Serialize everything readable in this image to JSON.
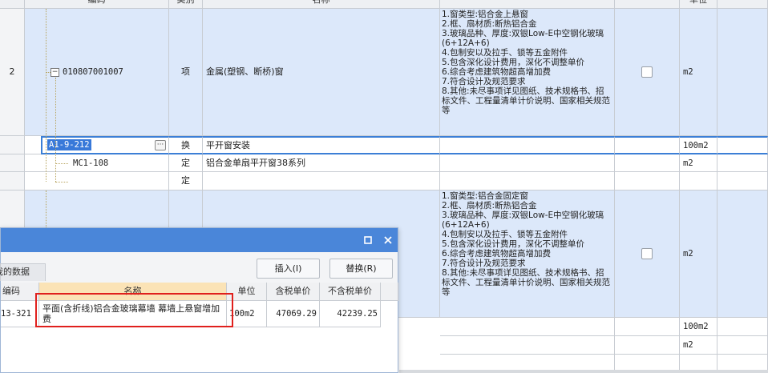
{
  "grid": {
    "header": {
      "code": "编码",
      "category": "类别",
      "name": "名称",
      "unit": "单位"
    },
    "rows": [
      {
        "num": "2",
        "code": "010807001007",
        "category": "项",
        "name": "金属(塑钢、断桥)窗",
        "features": "1.窗类型:铝合金上悬窗\n2.框、扇材质:断热铝合金\n3.玻璃品种、厚度:双银Low-E中空钢化玻璃(6+12A+6)\n4.包制安以及拉手、锁等五金附件\n5.包含深化设计费用，深化不调整单价\n6.综合考虑建筑物超高增加费\n7.符合设计及规范要求\n8.其他:未尽事项详见图纸、技术规格书、招标文件、工程量清单计价说明、国家相关规范等",
        "unit": "m2"
      },
      {
        "code": "A1-9-212",
        "category": "换",
        "name": "平开窗安装",
        "unit": "100m2",
        "edit_button": "···"
      },
      {
        "code": "MC1-108",
        "category": "定",
        "name": "铝合金单扇平开窗38系列",
        "unit": "m2"
      },
      {
        "code": "",
        "category": "定",
        "name": "",
        "unit": ""
      },
      {
        "features": "1.窗类型:铝合金固定窗\n2.框、扇材质:断热铝合金\n3.玻璃品种、厚度:双银Low-E中空钢化玻璃(6+12A+6)\n4.包制安以及拉手、锁等五金附件\n5.包含深化设计费用，深化不调整单价\n6.综合考虑建筑物超高增加费\n7.符合设计及规范要求\n8.其他:未尽事项详见图纸、技术规格书、招标文件、工程量清单计价说明、国家相关规范等",
        "unit": "m2"
      },
      {
        "unit": "100m2"
      },
      {
        "unit": "m2"
      }
    ]
  },
  "dialog": {
    "tab_label": "我的数据",
    "insert_button": "插入(I)",
    "replace_button": "替换(R)",
    "maximize_icon": "maximize-icon",
    "close_icon": "close-icon",
    "columns": {
      "code": "编码",
      "name": "名称",
      "unit": "单位",
      "tax_price": "含税单价",
      "notax_price": "不含税单价"
    },
    "row": {
      "code": "13-321",
      "name": "平面(含折线)铝合金玻璃幕墙 幕墙上悬窗增加费",
      "unit": "100m2",
      "tax_price": "47069.29",
      "notax_price": "42239.25"
    }
  },
  "colors": {
    "selection_blue": "#dce8fa",
    "accent": "#4a86d9",
    "highlight_red": "#e0201d"
  }
}
